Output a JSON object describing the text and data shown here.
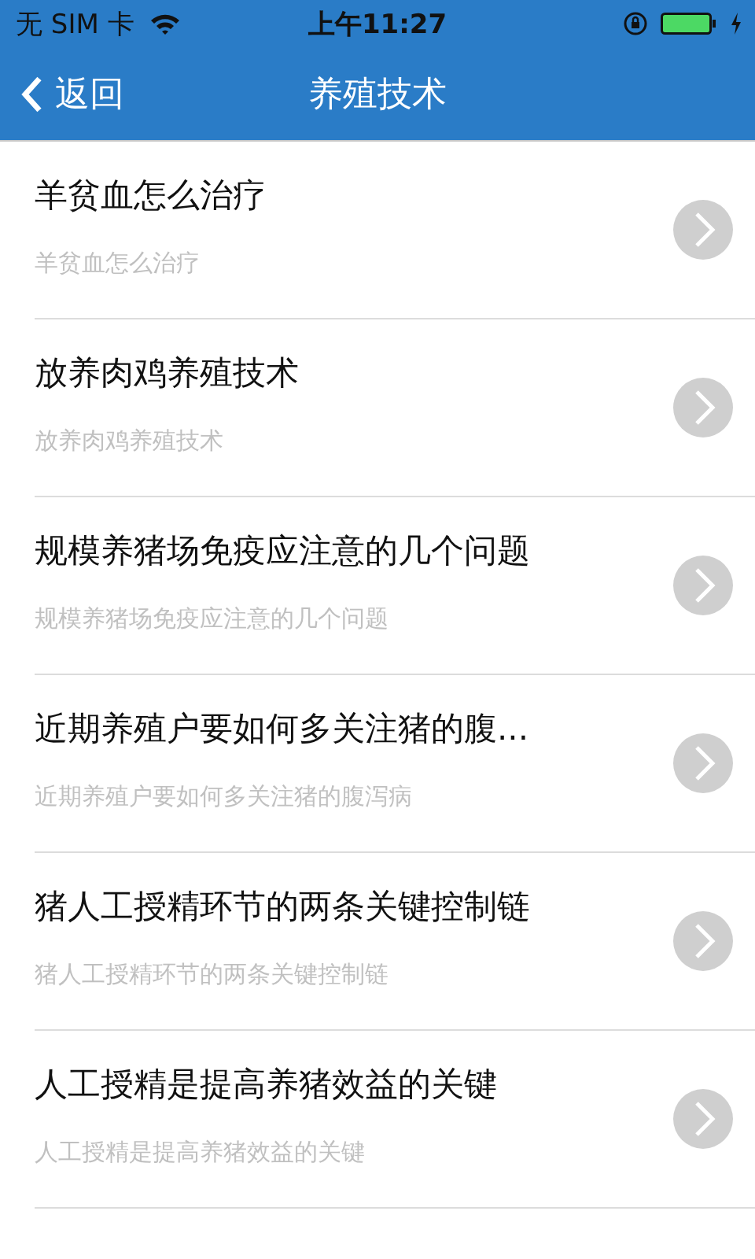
{
  "status_bar": {
    "carrier": "无 SIM 卡",
    "time": "上午11:27"
  },
  "nav_bar": {
    "back": "返回",
    "title": "养殖技术"
  },
  "items": [
    {
      "title": "羊贫血怎么治疗",
      "subtitle": "羊贫血怎么治疗"
    },
    {
      "title": "放养肉鸡养殖技术",
      "subtitle": "放养肉鸡养殖技术"
    },
    {
      "title": "规模养猪场免疫应注意的几个问题",
      "subtitle": "规模养猪场免疫应注意的几个问题"
    },
    {
      "title": "近期养殖户要如何多关注猪的腹...",
      "subtitle": "近期养殖户要如何多关注猪的腹泻病"
    },
    {
      "title": "猪人工授精环节的两条关键控制链",
      "subtitle": "猪人工授精环节的两条关键控制链"
    },
    {
      "title": "人工授精是提高养猪效益的关键",
      "subtitle": "人工授精是提高养猪效益的关键"
    }
  ]
}
